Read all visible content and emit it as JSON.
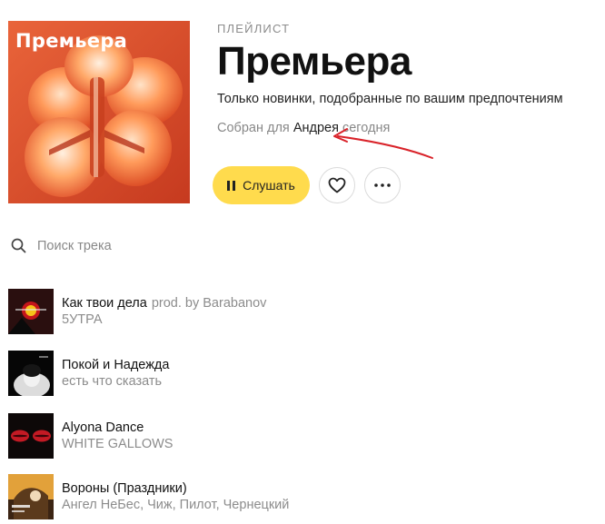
{
  "playlist": {
    "cover_text": "Премьера",
    "kind": "ПЛЕЙЛИСТ",
    "title": "Премьера",
    "description": "Только новинки, подобранные по вашим предпочтениям",
    "built_prefix": "Собран для",
    "built_user": "Андрея",
    "built_suffix": "сегодня"
  },
  "actions": {
    "play_label": "Слушать",
    "like_icon": "heart-icon",
    "more_icon": "more-icon"
  },
  "search": {
    "placeholder": "Поиск трека"
  },
  "tracks": [
    {
      "title": "Как твои дела",
      "version": "prod. by Barabanov",
      "artist": "5УТРА"
    },
    {
      "title": "Покой и Надежда",
      "version": "",
      "artist": "есть что сказать"
    },
    {
      "title": "Alyona Dance",
      "version": "",
      "artist": "WHITE GALLOWS"
    },
    {
      "title": "Вороны (Праздники)",
      "version": "",
      "artist": "Ангел НеБес, Чиж, Пилот, Чернецкий"
    }
  ],
  "colors": {
    "accent": "#ffdb4d",
    "annotation": "#d9232a",
    "cover_bg": "#e2542e"
  }
}
